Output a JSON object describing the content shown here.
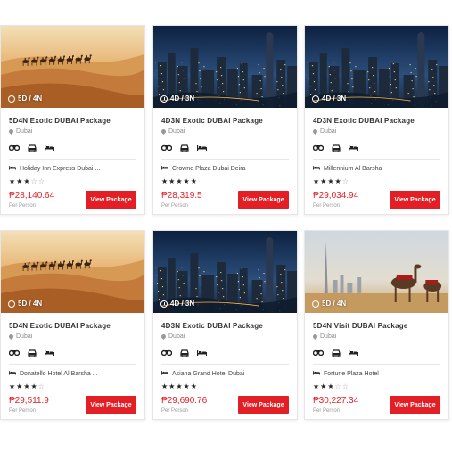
{
  "colors": {
    "accent": "#e31e24",
    "text": "#333333"
  },
  "amenity_icons": [
    "binoculars-icon",
    "car-icon",
    "bed-icon"
  ],
  "cards": [
    {
      "image": "desert-camels",
      "duration": "5D / 4N",
      "title": "5D4N Exotic DUBAI Package",
      "location": "Dubai",
      "hotel": "Holiday Inn Express Dubai ...",
      "stars": 3,
      "price": "₱28,140.64",
      "per": "Per Person",
      "button": "View Package"
    },
    {
      "image": "dubai-marina-night",
      "duration": "4D / 3N",
      "title": "4D3N Exotic DUBAI Package",
      "location": "Dubai",
      "hotel": "Crowne Plaza Dubai Deira",
      "stars": 5,
      "price": "₱28,319.5",
      "per": "Per Person",
      "button": "View Package"
    },
    {
      "image": "dubai-marina-night",
      "duration": "4D / 3N",
      "title": "4D3N Exotic DUBAI Package",
      "location": "Dubai",
      "hotel": "Millennium Al Barsha",
      "stars": 4,
      "price": "₱29,034.94",
      "per": "Per Person",
      "button": "View Package"
    },
    {
      "image": "desert-camels",
      "duration": "5D / 4N",
      "title": "5D4N Exotic DUBAI Package",
      "location": "Dubai",
      "hotel": "Donatello Hotel Al Barsha ...",
      "stars": 4,
      "price": "₱29,511.9",
      "per": "Per Person",
      "button": "View Package"
    },
    {
      "image": "dubai-marina-night",
      "duration": "4D / 3N",
      "title": "4D3N Exotic DUBAI Package",
      "location": "Dubai",
      "hotel": "Asiana Grand Hotel Dubai",
      "stars": 5,
      "price": "₱29,690.76",
      "per": "Per Person",
      "button": "View Package"
    },
    {
      "image": "burj-camels-day",
      "duration": "5D / 4N",
      "title": "5D4N Visit DUBAI Package",
      "location": "Dubai",
      "hotel": "Fortune Plaza Hotel",
      "stars": 3,
      "price": "₱30,227.34",
      "per": "Per Person",
      "button": "View Package"
    }
  ]
}
